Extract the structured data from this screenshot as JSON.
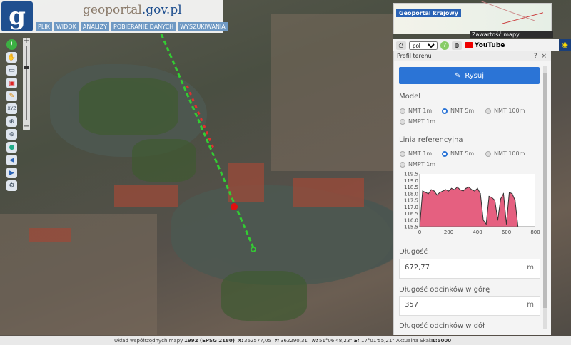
{
  "header": {
    "logo_letter": "g",
    "logo_text_a": "geoportal",
    "logo_text_b": ".gov.pl",
    "menu": [
      "PLIK",
      "WIDOK",
      "ANALIZY",
      "POBIERANIE DANYCH",
      "WYSZUKIWANIA"
    ]
  },
  "left_toolbar": {
    "icons": [
      "info-icon",
      "hand-icon",
      "measure-icon",
      "select-icon",
      "pencil-icon",
      "xyz-icon",
      "zoom-in-icon",
      "zoom-out-icon",
      "globe-icon",
      "arrow-left-icon",
      "arrow-right-icon",
      "settings-icon"
    ],
    "xyz_label": "XYZ",
    "zoom_plus": "+",
    "zoom_minus": "−"
  },
  "minimap": {
    "title": "Geoportal krajowy",
    "contents_label": "Zawartość mapy"
  },
  "top_tools": {
    "language": "pol",
    "youtube_label": "YouTube"
  },
  "panel": {
    "title": "Profil terenu",
    "help": "?",
    "close": "×",
    "draw_button": "Rysuj",
    "model_label": "Model",
    "model_options": [
      "NMT 1m",
      "NMT 5m",
      "NMT 100m",
      "NMPT 1m"
    ],
    "model_selected": "NMT 5m",
    "ref_label": "Linia referencyjna",
    "ref_options": [
      "NMT 1m",
      "NMT 5m",
      "NMT 100m",
      "NMPT 1m"
    ],
    "ref_selected": "NMT 5m",
    "length_label": "Długość",
    "length_value": "672,77",
    "length_unit": "m",
    "up_label": "Długość odcinków w górę",
    "up_value": "357",
    "up_unit": "m",
    "down_label": "Długość odcinków w dół"
  },
  "chart_data": {
    "type": "area",
    "x": [
      0,
      20,
      40,
      60,
      80,
      100,
      120,
      140,
      160,
      180,
      200,
      220,
      240,
      260,
      280,
      300,
      320,
      340,
      360,
      380,
      400,
      420,
      440,
      460,
      480,
      500,
      520,
      540,
      560,
      580,
      600,
      620,
      640,
      660,
      680
    ],
    "values": [
      115.5,
      118.2,
      118.1,
      118.0,
      118.3,
      118.2,
      117.9,
      118.1,
      118.2,
      118.3,
      118.2,
      118.4,
      118.3,
      118.5,
      118.3,
      118.2,
      118.4,
      118.5,
      118.3,
      118.2,
      118.4,
      118.0,
      116.0,
      115.7,
      117.8,
      117.7,
      117.5,
      116.0,
      117.6,
      118.0,
      115.7,
      118.1,
      118.0,
      117.5,
      115.5
    ],
    "y_ticks": [
      "115.5",
      "116.0",
      "116.5",
      "117.0",
      "117.5",
      "118.0",
      "118.5",
      "119.0",
      "119.5"
    ],
    "x_ticks": [
      "0",
      "200",
      "400",
      "600",
      "800"
    ],
    "xlim": [
      0,
      800
    ],
    "ylim": [
      115.5,
      119.5
    ],
    "fill_color": "#e0446a",
    "line_color": "#333333"
  },
  "status": {
    "crs_label": "Układ współrzędnych mapy",
    "crs_value": "1992 (EPSG 2180)",
    "x_label": "X:",
    "x_value": "362577,05",
    "y_label": "Y:",
    "y_value": "362290,31",
    "n_label": "N:",
    "n_value": "51°06'48,23\"",
    "e_label": "E:",
    "e_value": "17°01'55,21\"",
    "scale_label": "Aktualna Skala",
    "scale_value": "1:5000"
  }
}
